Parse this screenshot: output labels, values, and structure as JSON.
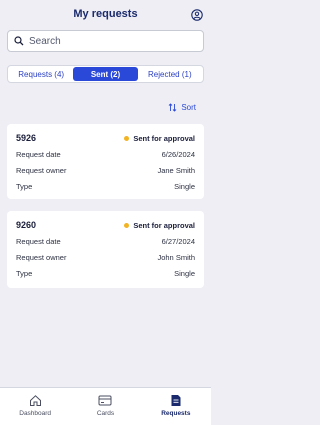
{
  "header": {
    "title": "My requests",
    "profile_icon": "user-circle-icon"
  },
  "search": {
    "placeholder": "Search"
  },
  "tabs": [
    {
      "label": "Requests (4)",
      "active": false
    },
    {
      "label": "Sent (2)",
      "active": true
    },
    {
      "label": "Rejected (1)",
      "active": false
    }
  ],
  "sort": {
    "label": "Sort",
    "icon": "sort-arrows-icon"
  },
  "cards": [
    {
      "id": "5926",
      "status": "Sent for approval",
      "rows": [
        {
          "label": "Request date",
          "value": "6/26/2024"
        },
        {
          "label": "Request owner",
          "value": "Jane Smith"
        },
        {
          "label": "Type",
          "value": "Single"
        }
      ]
    },
    {
      "id": "9260",
      "status": "Sent for approval",
      "rows": [
        {
          "label": "Request date",
          "value": "6/27/2024"
        },
        {
          "label": "Request owner",
          "value": "John Smith"
        },
        {
          "label": "Type",
          "value": "Single"
        }
      ]
    }
  ],
  "bottom_nav": [
    {
      "label": "Dashboard",
      "icon": "home-icon",
      "active": false
    },
    {
      "label": "Cards",
      "icon": "card-icon",
      "active": false
    },
    {
      "label": "Requests",
      "icon": "document-icon",
      "active": true
    }
  ],
  "colors": {
    "accent": "#2a49d8",
    "title": "#1a2a6c",
    "status_dot": "#f2b424",
    "background": "#eeeef4"
  }
}
